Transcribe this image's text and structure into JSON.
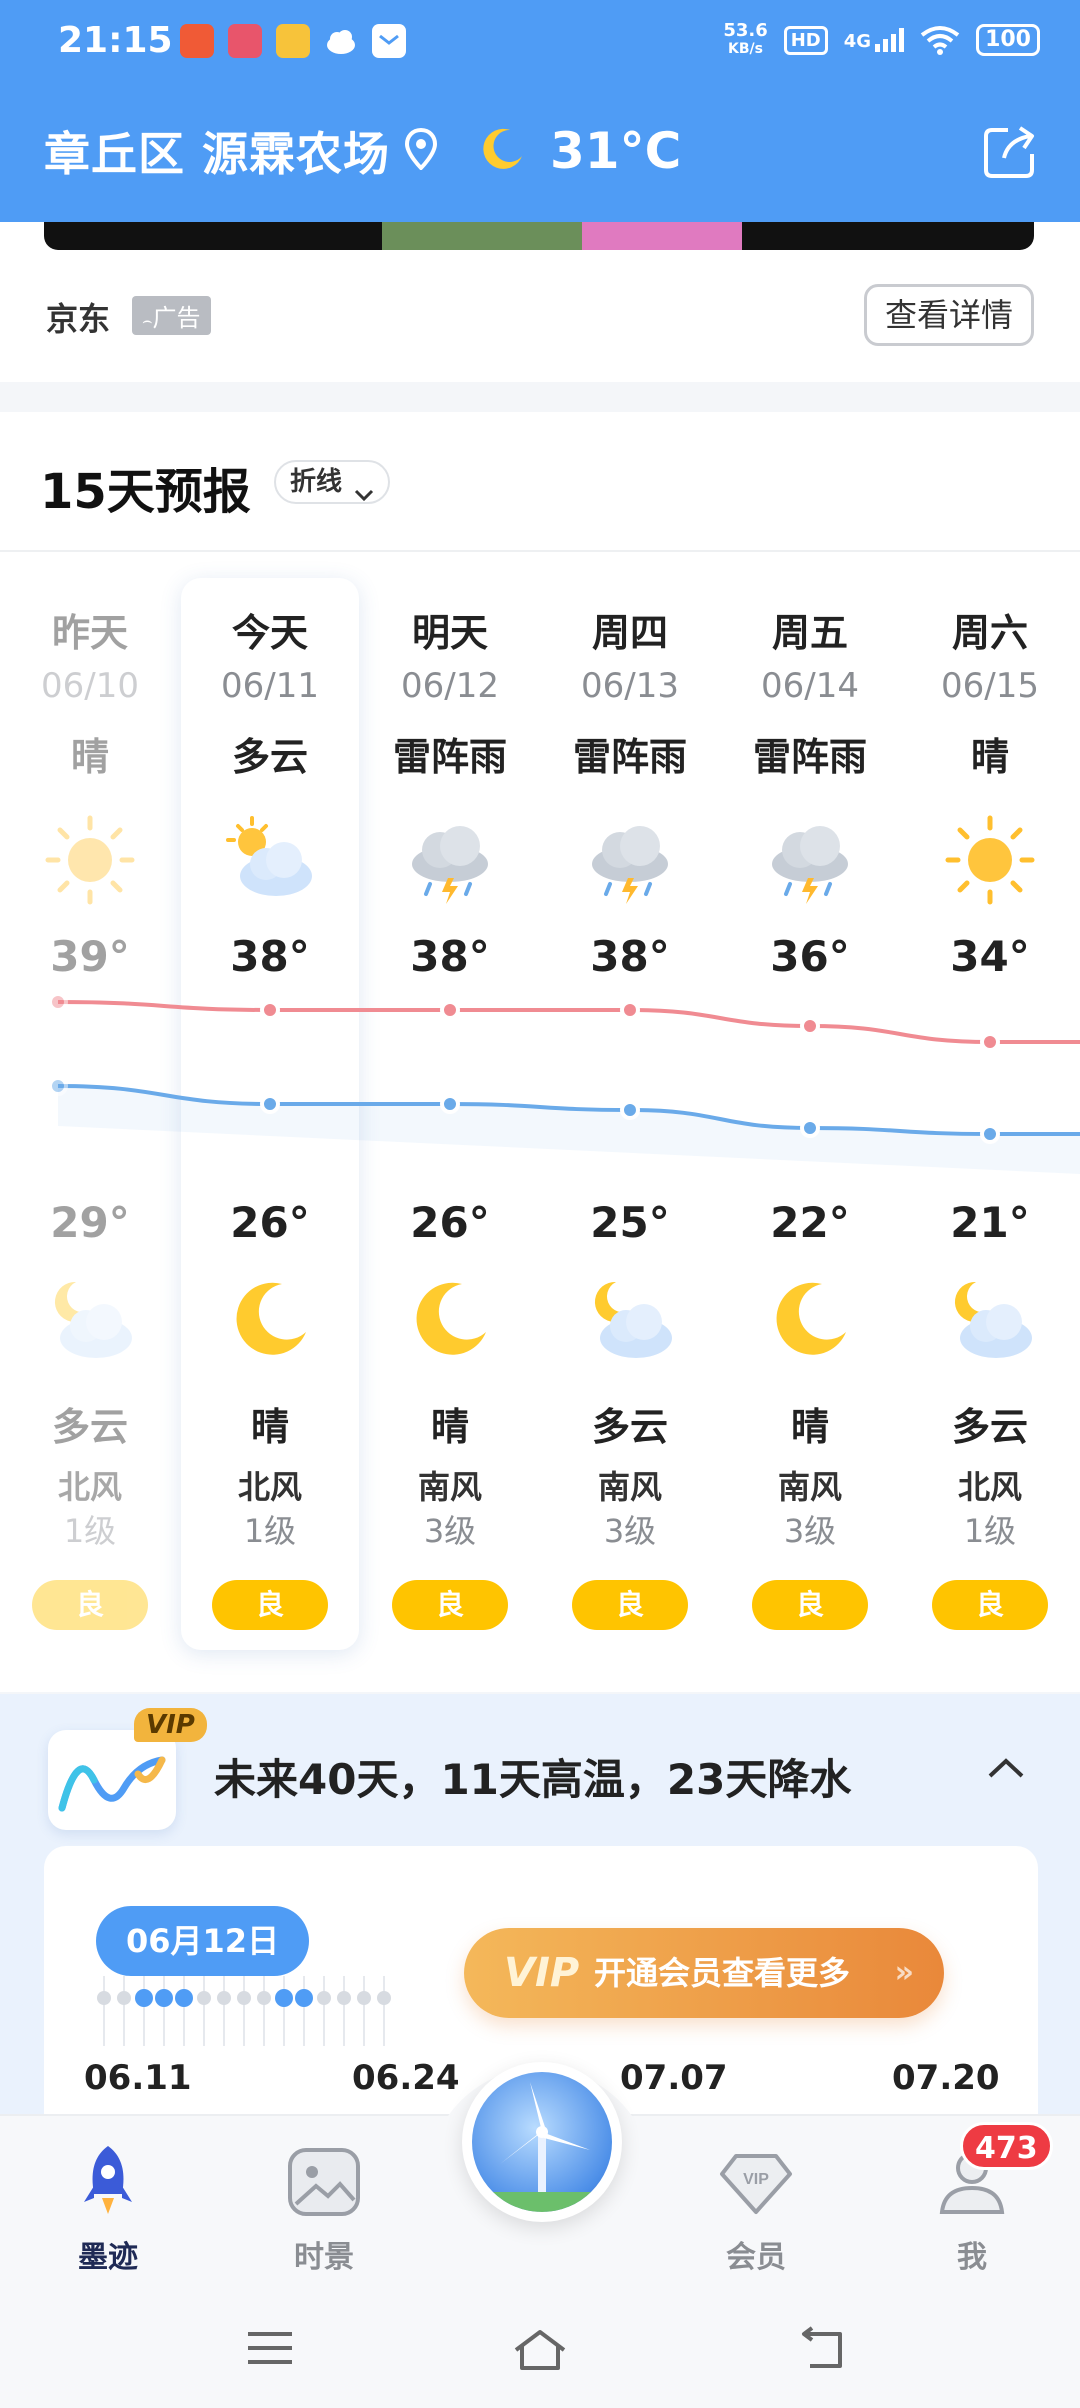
{
  "status_bar": {
    "time": "21:15",
    "net_speed_value": "53.6",
    "net_speed_unit": "KB/s",
    "hd": "HD",
    "network": "4G",
    "battery": "100"
  },
  "header": {
    "location": "章丘区 源霖农场",
    "current_temp": "31°C",
    "icons": [
      "location-pin-icon",
      "moon-icon",
      "share-icon"
    ]
  },
  "ad": {
    "source": "京东",
    "tag": "广告",
    "detail_button": "查看详情"
  },
  "forecast": {
    "title": "15天预报",
    "view_toggle": "折线",
    "days": [
      {
        "day": "昨天",
        "date": "06/10",
        "day_weather": "晴",
        "day_icon": "sunny-icon",
        "high": "39°",
        "low": "29°",
        "night_icon": "cloudy-night-icon",
        "night_weather": "多云",
        "wind": "北风",
        "level": "1级",
        "aqi": "良"
      },
      {
        "day": "今天",
        "date": "06/11",
        "day_weather": "多云",
        "day_icon": "partly-cloudy-icon",
        "high": "38°",
        "low": "26°",
        "night_icon": "moon-icon",
        "night_weather": "晴",
        "wind": "北风",
        "level": "1级",
        "aqi": "良"
      },
      {
        "day": "明天",
        "date": "06/12",
        "day_weather": "雷阵雨",
        "day_icon": "thunderstorm-icon",
        "high": "38°",
        "low": "26°",
        "night_icon": "moon-icon",
        "night_weather": "晴",
        "wind": "南风",
        "level": "3级",
        "aqi": "良"
      },
      {
        "day": "周四",
        "date": "06/13",
        "day_weather": "雷阵雨",
        "day_icon": "thunderstorm-icon",
        "high": "38°",
        "low": "25°",
        "night_icon": "cloudy-night-icon",
        "night_weather": "多云",
        "wind": "南风",
        "level": "3级",
        "aqi": "良"
      },
      {
        "day": "周五",
        "date": "06/14",
        "day_weather": "雷阵雨",
        "day_icon": "thunderstorm-icon",
        "high": "36°",
        "low": "22°",
        "night_icon": "moon-icon",
        "night_weather": "晴",
        "wind": "南风",
        "level": "3级",
        "aqi": "良"
      },
      {
        "day": "周六",
        "date": "06/15",
        "day_weather": "晴",
        "day_icon": "sunny-icon",
        "high": "34°",
        "low": "21°",
        "night_icon": "cloudy-night-icon",
        "night_weather": "多云",
        "wind": "北风",
        "level": "1级",
        "aqi": "良"
      }
    ],
    "colors": {
      "high_line": "#f08b92",
      "low_line": "#6aaae9",
      "aqi_good": "#ffc400",
      "accent": "#4f9cf5"
    }
  },
  "chart_data": {
    "type": "line",
    "categories": [
      "06/10",
      "06/11",
      "06/12",
      "06/13",
      "06/14",
      "06/15"
    ],
    "series": [
      {
        "values": [
          39,
          38,
          38,
          38,
          36,
          34
        ]
      },
      {
        "values": [
          29,
          26,
          26,
          25,
          22,
          21
        ]
      }
    ]
  },
  "forty_day": {
    "vip_badge": "VIP",
    "summary": "未来40天，11天高温，23天降水",
    "selected_date": "06月12日",
    "vip_button": "开通会员查看更多",
    "vip_mark": "VIP",
    "axis_dates": [
      "06.11",
      "06.24",
      "07.07",
      "07.20"
    ]
  },
  "bottom_nav": {
    "items": [
      {
        "label": "墨迹",
        "icon": "rocket-icon"
      },
      {
        "label": "时景",
        "icon": "image-icon"
      },
      {
        "label": "会员",
        "icon": "vip-diamond-icon"
      },
      {
        "label": "我",
        "icon": "user-icon"
      }
    ],
    "badge": "473",
    "center_icon": "wind-turbine-icon"
  }
}
